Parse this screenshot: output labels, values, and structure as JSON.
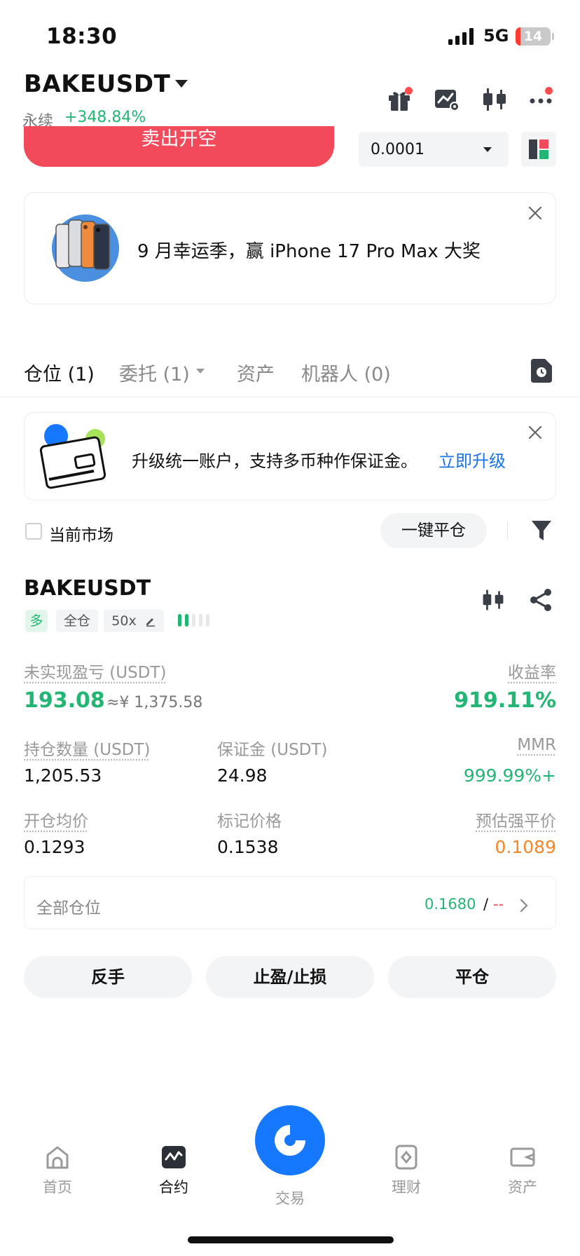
{
  "status_bar": {
    "time": "18:30",
    "network": "5G",
    "battery": "14",
    "battery_percent": 14
  },
  "header": {
    "pair": "BAKEUSDT",
    "type_label": "永续",
    "change": "+348.84%",
    "icons": [
      "gift-icon",
      "chart-settings-icon",
      "candlestick-icon",
      "more-icon"
    ]
  },
  "order": {
    "sell_label": "卖出开空",
    "quantity": "0.0001"
  },
  "promo": {
    "text": "9 月幸运季，赢 iPhone 17 Pro Max 大奖"
  },
  "tabs": [
    {
      "label": "仓位 (1)",
      "active": true
    },
    {
      "label": "委托 (1)",
      "active": false
    },
    {
      "label": "资产",
      "active": false
    },
    {
      "label": "机器人 (0)",
      "active": false
    }
  ],
  "upgrade": {
    "text": "升级统一账户，支持多币种作保证金。",
    "link": "立即升级"
  },
  "filter": {
    "current_market": "当前市场",
    "close_all": "一键平仓"
  },
  "position": {
    "symbol": "BAKEUSDT",
    "side": "多",
    "margin_mode": "全仓",
    "leverage": "50x",
    "adl_level": 2,
    "unrealized_label": "未实现盈亏 (USDT)",
    "unrealized_value": "193.08",
    "unrealized_cny": "≈¥ 1,375.58",
    "roe_label": "收益率",
    "roe_value": "919.11%",
    "size_label": "持仓数量 (USDT)",
    "size_value": "1,205.53",
    "margin_label": "保证金 (USDT)",
    "margin_value": "24.98",
    "mmr_label": "MMR",
    "mmr_value": "999.99%+",
    "entry_label": "开仓均价",
    "entry_value": "0.1293",
    "mark_label": "标记价格",
    "mark_value": "0.1538",
    "liq_label": "预估强平价",
    "liq_value": "0.1089",
    "all_positions_label": "全部仓位",
    "all_positions_value": "0.1680",
    "all_positions_slash": "/",
    "all_positions_dash": "--"
  },
  "actions": {
    "reverse": "反手",
    "tpsl": "止盈/止损",
    "close": "平仓"
  },
  "nav": {
    "home": "首页",
    "futures": "合约",
    "trade": "交易",
    "earn": "理财",
    "assets": "资产"
  },
  "colors": {
    "green": "#22b573",
    "red": "#f24a5b",
    "orange": "#f5872b",
    "blue": "#1677ff",
    "link": "#1a73e8"
  }
}
